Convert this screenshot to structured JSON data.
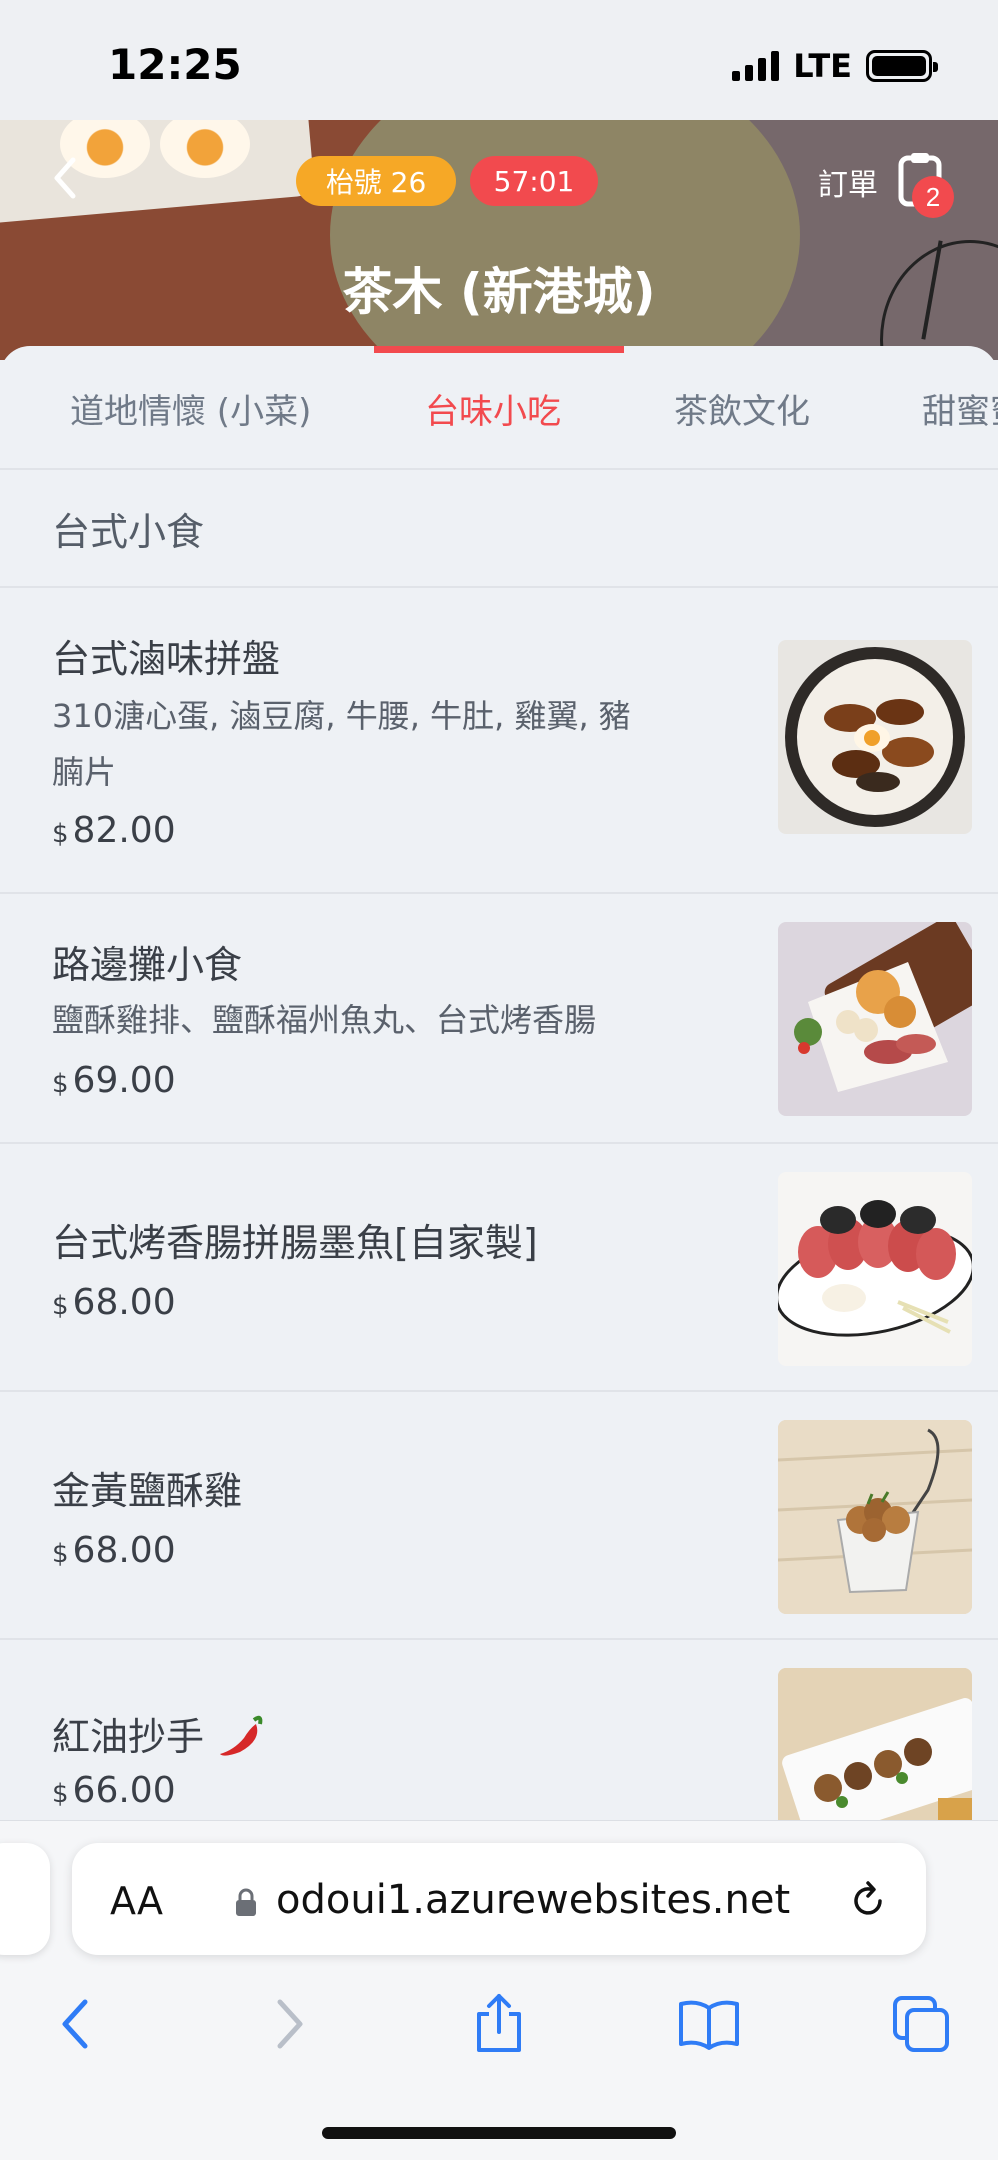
{
  "status_bar": {
    "time": "12:25",
    "network": "LTE"
  },
  "header": {
    "table_pill": "枱號 26",
    "timer_pill": "57:01",
    "order_label": "訂單",
    "order_count": "2",
    "store_name": "茶木 (新港城)"
  },
  "tabs": [
    {
      "label": "道地情懷 (小菜)",
      "active": false
    },
    {
      "label": "台味小吃",
      "active": true
    },
    {
      "label": "茶飲文化",
      "active": false
    },
    {
      "label": "甜蜜蜜",
      "active": false
    }
  ],
  "section": {
    "title": "台式小食"
  },
  "items": [
    {
      "name": "台式滷味拼盤",
      "desc_line1": "310溏心蛋, 滷豆腐, 牛腰, 牛肚, 雞翼, 豬",
      "desc_line2": "腩片",
      "currency": "$",
      "price": "82.00",
      "image": "braised-platter-photo"
    },
    {
      "name": "路邊攤小食",
      "desc_line1": "鹽酥雞排、鹽酥福州魚丸、台式烤香腸",
      "currency": "$",
      "price": "69.00",
      "image": "street-snacks-photo"
    },
    {
      "name": "台式烤香腸拼腸墨魚[自家製]",
      "currency": "$",
      "price": "68.00",
      "image": "sausage-squid-photo"
    },
    {
      "name": "金黃鹽酥雞",
      "currency": "$",
      "price": "68.00",
      "image": "popcorn-chicken-photo"
    },
    {
      "name": "紅油抄手",
      "currency": "$",
      "price": "66.00",
      "image": "chili-wontons-photo",
      "icon": "chili-pepper-icon"
    }
  ],
  "browser": {
    "text_size_label": "AA",
    "url": "odoui1.azurewebsites.net"
  },
  "colors": {
    "accent": "#f24a4e",
    "table_pill": "#f6a826",
    "background": "#eef1f5",
    "ios_blue": "#2f7cf6"
  }
}
